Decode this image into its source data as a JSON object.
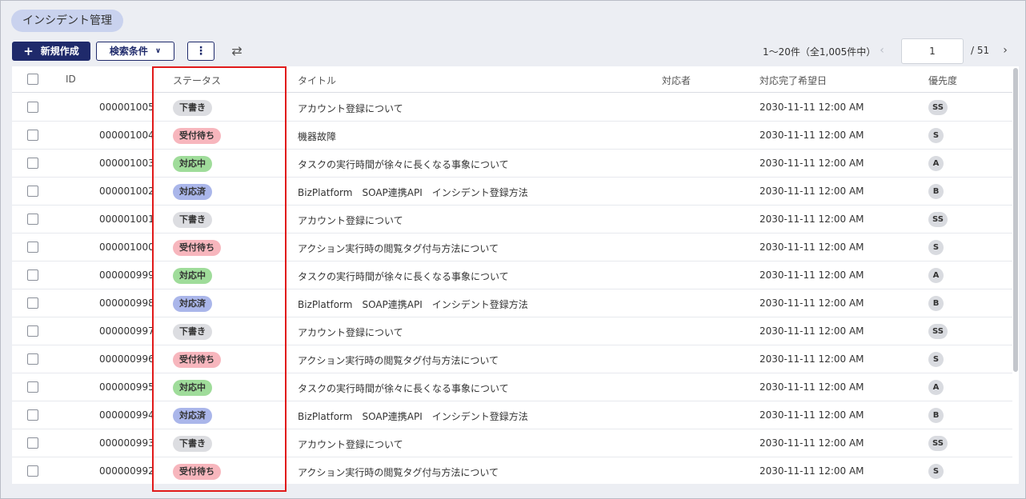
{
  "page": {
    "title": "インシデント管理"
  },
  "toolbar": {
    "create_label": "新規作成",
    "search_label": "検索条件",
    "more_label": "⋮",
    "swap_label": "⇄"
  },
  "pager": {
    "count_text": "1〜20件（全1,005件中）",
    "current_page": "1",
    "total_text": "/ 51"
  },
  "table": {
    "columns": {
      "id": "ID",
      "status": "ステータス",
      "title": "タイトル",
      "assignee": "対応者",
      "due": "対応完了希望日",
      "priority": "優先度"
    },
    "rows": [
      {
        "id": "000001005",
        "status": "下書き",
        "title": "アカウント登録について",
        "assignee": "",
        "due": "2030-11-11 12:00 AM",
        "priority": "SS"
      },
      {
        "id": "000001004",
        "status": "受付待ち",
        "title": "機器故障",
        "assignee": "",
        "due": "2030-11-11 12:00 AM",
        "priority": "S"
      },
      {
        "id": "000001003",
        "status": "対応中",
        "title": "タスクの実行時間が徐々に長くなる事象について",
        "assignee": "",
        "due": "2030-11-11 12:00 AM",
        "priority": "A"
      },
      {
        "id": "000001002",
        "status": "対応済",
        "title": "BizPlatform　SOAP連携API　インシデント登録方法",
        "assignee": "",
        "due": "2030-11-11 12:00 AM",
        "priority": "B"
      },
      {
        "id": "000001001",
        "status": "下書き",
        "title": "アカウント登録について",
        "assignee": "",
        "due": "2030-11-11 12:00 AM",
        "priority": "SS"
      },
      {
        "id": "000001000",
        "status": "受付待ち",
        "title": "アクション実行時の閲覧タグ付与方法について",
        "assignee": "",
        "due": "2030-11-11 12:00 AM",
        "priority": "S"
      },
      {
        "id": "000000999",
        "status": "対応中",
        "title": "タスクの実行時間が徐々に長くなる事象について",
        "assignee": "",
        "due": "2030-11-11 12:00 AM",
        "priority": "A"
      },
      {
        "id": "000000998",
        "status": "対応済",
        "title": "BizPlatform　SOAP連携API　インシデント登録方法",
        "assignee": "",
        "due": "2030-11-11 12:00 AM",
        "priority": "B"
      },
      {
        "id": "000000997",
        "status": "下書き",
        "title": "アカウント登録について",
        "assignee": "",
        "due": "2030-11-11 12:00 AM",
        "priority": "SS"
      },
      {
        "id": "000000996",
        "status": "受付待ち",
        "title": "アクション実行時の閲覧タグ付与方法について",
        "assignee": "",
        "due": "2030-11-11 12:00 AM",
        "priority": "S"
      },
      {
        "id": "000000995",
        "status": "対応中",
        "title": "タスクの実行時間が徐々に長くなる事象について",
        "assignee": "",
        "due": "2030-11-11 12:00 AM",
        "priority": "A"
      },
      {
        "id": "000000994",
        "status": "対応済",
        "title": "BizPlatform　SOAP連携API　インシデント登録方法",
        "assignee": "",
        "due": "2030-11-11 12:00 AM",
        "priority": "B"
      },
      {
        "id": "000000993",
        "status": "下書き",
        "title": "アカウント登録について",
        "assignee": "",
        "due": "2030-11-11 12:00 AM",
        "priority": "SS"
      },
      {
        "id": "000000992",
        "status": "受付待ち",
        "title": "アクション実行時の閲覧タグ付与方法について",
        "assignee": "",
        "due": "2030-11-11 12:00 AM",
        "priority": "S"
      }
    ]
  },
  "status_colors": {
    "下書き": "#dcdde1",
    "受付待ち": "#f7b6bd",
    "対応中": "#9fdc9a",
    "対応済": "#aab6ea"
  },
  "highlight_color": "#e11a1a"
}
